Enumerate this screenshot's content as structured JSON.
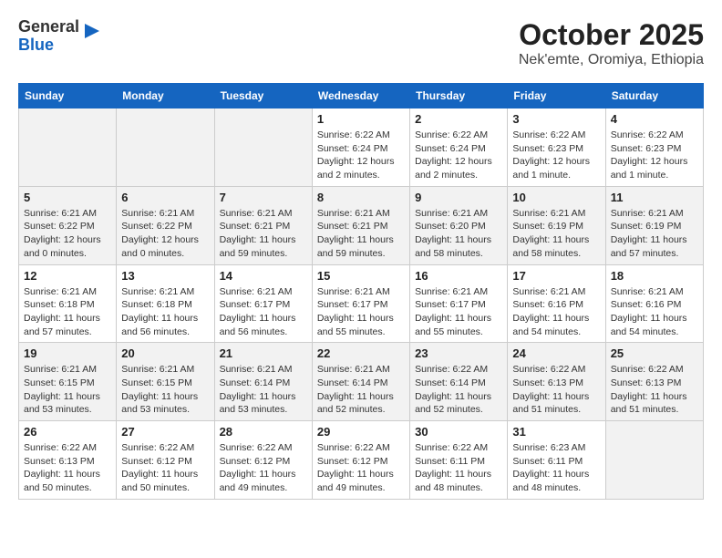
{
  "header": {
    "logo_general": "General",
    "logo_blue": "Blue",
    "title": "October 2025",
    "subtitle": "Nek'emte, Oromiya, Ethiopia"
  },
  "calendar": {
    "days_of_week": [
      "Sunday",
      "Monday",
      "Tuesday",
      "Wednesday",
      "Thursday",
      "Friday",
      "Saturday"
    ],
    "weeks": [
      [
        {
          "day": "",
          "info": ""
        },
        {
          "day": "",
          "info": ""
        },
        {
          "day": "",
          "info": ""
        },
        {
          "day": "1",
          "info": "Sunrise: 6:22 AM\nSunset: 6:24 PM\nDaylight: 12 hours\nand 2 minutes."
        },
        {
          "day": "2",
          "info": "Sunrise: 6:22 AM\nSunset: 6:24 PM\nDaylight: 12 hours\nand 2 minutes."
        },
        {
          "day": "3",
          "info": "Sunrise: 6:22 AM\nSunset: 6:23 PM\nDaylight: 12 hours\nand 1 minute."
        },
        {
          "day": "4",
          "info": "Sunrise: 6:22 AM\nSunset: 6:23 PM\nDaylight: 12 hours\nand 1 minute."
        }
      ],
      [
        {
          "day": "5",
          "info": "Sunrise: 6:21 AM\nSunset: 6:22 PM\nDaylight: 12 hours\nand 0 minutes."
        },
        {
          "day": "6",
          "info": "Sunrise: 6:21 AM\nSunset: 6:22 PM\nDaylight: 12 hours\nand 0 minutes."
        },
        {
          "day": "7",
          "info": "Sunrise: 6:21 AM\nSunset: 6:21 PM\nDaylight: 11 hours\nand 59 minutes."
        },
        {
          "day": "8",
          "info": "Sunrise: 6:21 AM\nSunset: 6:21 PM\nDaylight: 11 hours\nand 59 minutes."
        },
        {
          "day": "9",
          "info": "Sunrise: 6:21 AM\nSunset: 6:20 PM\nDaylight: 11 hours\nand 58 minutes."
        },
        {
          "day": "10",
          "info": "Sunrise: 6:21 AM\nSunset: 6:19 PM\nDaylight: 11 hours\nand 58 minutes."
        },
        {
          "day": "11",
          "info": "Sunrise: 6:21 AM\nSunset: 6:19 PM\nDaylight: 11 hours\nand 57 minutes."
        }
      ],
      [
        {
          "day": "12",
          "info": "Sunrise: 6:21 AM\nSunset: 6:18 PM\nDaylight: 11 hours\nand 57 minutes."
        },
        {
          "day": "13",
          "info": "Sunrise: 6:21 AM\nSunset: 6:18 PM\nDaylight: 11 hours\nand 56 minutes."
        },
        {
          "day": "14",
          "info": "Sunrise: 6:21 AM\nSunset: 6:17 PM\nDaylight: 11 hours\nand 56 minutes."
        },
        {
          "day": "15",
          "info": "Sunrise: 6:21 AM\nSunset: 6:17 PM\nDaylight: 11 hours\nand 55 minutes."
        },
        {
          "day": "16",
          "info": "Sunrise: 6:21 AM\nSunset: 6:17 PM\nDaylight: 11 hours\nand 55 minutes."
        },
        {
          "day": "17",
          "info": "Sunrise: 6:21 AM\nSunset: 6:16 PM\nDaylight: 11 hours\nand 54 minutes."
        },
        {
          "day": "18",
          "info": "Sunrise: 6:21 AM\nSunset: 6:16 PM\nDaylight: 11 hours\nand 54 minutes."
        }
      ],
      [
        {
          "day": "19",
          "info": "Sunrise: 6:21 AM\nSunset: 6:15 PM\nDaylight: 11 hours\nand 53 minutes."
        },
        {
          "day": "20",
          "info": "Sunrise: 6:21 AM\nSunset: 6:15 PM\nDaylight: 11 hours\nand 53 minutes."
        },
        {
          "day": "21",
          "info": "Sunrise: 6:21 AM\nSunset: 6:14 PM\nDaylight: 11 hours\nand 53 minutes."
        },
        {
          "day": "22",
          "info": "Sunrise: 6:21 AM\nSunset: 6:14 PM\nDaylight: 11 hours\nand 52 minutes."
        },
        {
          "day": "23",
          "info": "Sunrise: 6:22 AM\nSunset: 6:14 PM\nDaylight: 11 hours\nand 52 minutes."
        },
        {
          "day": "24",
          "info": "Sunrise: 6:22 AM\nSunset: 6:13 PM\nDaylight: 11 hours\nand 51 minutes."
        },
        {
          "day": "25",
          "info": "Sunrise: 6:22 AM\nSunset: 6:13 PM\nDaylight: 11 hours\nand 51 minutes."
        }
      ],
      [
        {
          "day": "26",
          "info": "Sunrise: 6:22 AM\nSunset: 6:13 PM\nDaylight: 11 hours\nand 50 minutes."
        },
        {
          "day": "27",
          "info": "Sunrise: 6:22 AM\nSunset: 6:12 PM\nDaylight: 11 hours\nand 50 minutes."
        },
        {
          "day": "28",
          "info": "Sunrise: 6:22 AM\nSunset: 6:12 PM\nDaylight: 11 hours\nand 49 minutes."
        },
        {
          "day": "29",
          "info": "Sunrise: 6:22 AM\nSunset: 6:12 PM\nDaylight: 11 hours\nand 49 minutes."
        },
        {
          "day": "30",
          "info": "Sunrise: 6:22 AM\nSunset: 6:11 PM\nDaylight: 11 hours\nand 48 minutes."
        },
        {
          "day": "31",
          "info": "Sunrise: 6:23 AM\nSunset: 6:11 PM\nDaylight: 11 hours\nand 48 minutes."
        },
        {
          "day": "",
          "info": ""
        }
      ]
    ]
  }
}
